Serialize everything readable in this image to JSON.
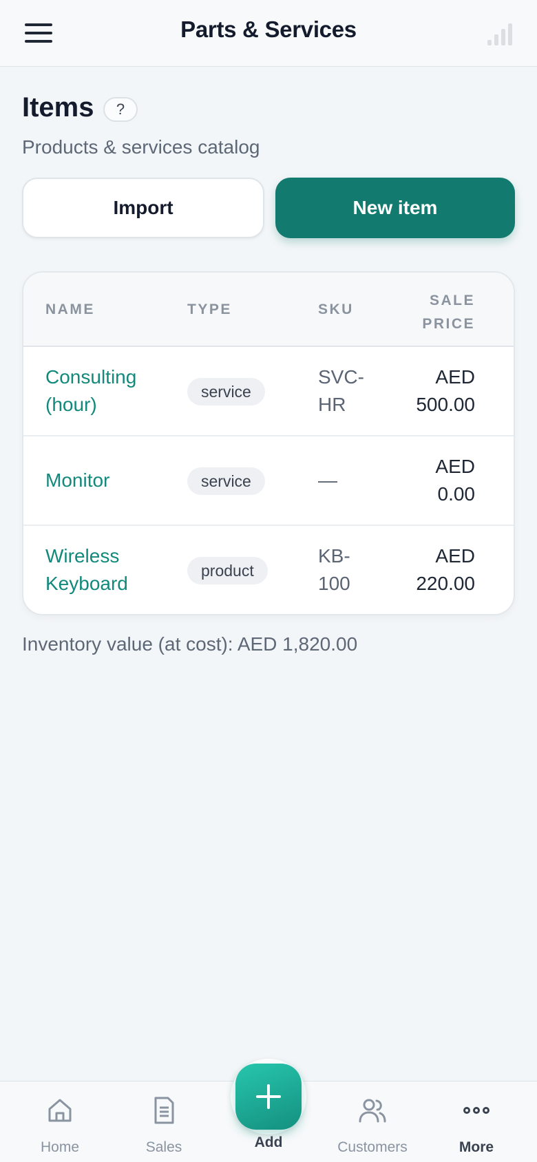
{
  "header": {
    "title": "Parts & Services",
    "menu_icon": "hamburger-menu-icon",
    "signal_icon": "signal-bars-icon"
  },
  "page": {
    "title": "Items",
    "help_label": "?",
    "subtitle": "Products & services catalog"
  },
  "actions": {
    "import_label": "Import",
    "new_item_label": "New item",
    "accent_color": "#127a6e"
  },
  "table": {
    "columns": [
      "NAME",
      "TYPE",
      "SKU",
      "SALE PRICE"
    ],
    "price_header_line1": "SALE",
    "price_header_line2": "PRICE",
    "rows": [
      {
        "name": "Consulting (hour)",
        "type": "service",
        "sku": "SVC-HR",
        "price_currency": "AED",
        "price_amount": "500.00"
      },
      {
        "name": "Monitor",
        "type": "service",
        "sku": "—",
        "price_currency": "AED",
        "price_amount": "0.00"
      },
      {
        "name": "Wireless Keyboard",
        "type": "product",
        "sku": "KB-100",
        "price_currency": "AED",
        "price_amount": "220.00"
      }
    ]
  },
  "inventory_note": "Inventory value (at cost): AED 1,820.00",
  "bottom_nav": {
    "items": [
      {
        "label": "Home",
        "icon": "home-icon"
      },
      {
        "label": "Sales",
        "icon": "receipt-icon"
      },
      {
        "label": "Add",
        "icon": "plus-icon"
      },
      {
        "label": "Customers",
        "icon": "users-icon"
      },
      {
        "label": "More",
        "icon": "more-dots-icon"
      }
    ]
  }
}
